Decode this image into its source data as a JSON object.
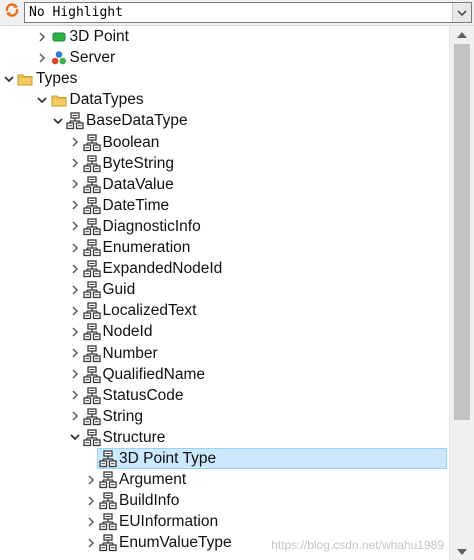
{
  "toolbar": {
    "refresh_icon": "refresh-icon",
    "highlight_value": "No Highlight"
  },
  "tree": {
    "rows": [
      {
        "label": "3D Point",
        "level": 1,
        "expander": "collapsed",
        "icon": "green-object-icon"
      },
      {
        "label": "Server",
        "level": 1,
        "expander": "collapsed",
        "icon": "server-icon"
      },
      {
        "label": "Types",
        "level": 0,
        "expander": "expanded",
        "icon": "folder-icon"
      },
      {
        "label": "DataTypes",
        "level": 1,
        "expander": "expanded",
        "icon": "folder-icon"
      },
      {
        "label": "BaseDataType",
        "level": 2,
        "expander": "expanded",
        "icon": "datatype-icon"
      },
      {
        "label": "Boolean",
        "level": 3,
        "expander": "collapsed",
        "icon": "datatype-icon"
      },
      {
        "label": "ByteString",
        "level": 3,
        "expander": "collapsed",
        "icon": "datatype-icon"
      },
      {
        "label": "DataValue",
        "level": 3,
        "expander": "collapsed",
        "icon": "datatype-icon"
      },
      {
        "label": "DateTime",
        "level": 3,
        "expander": "collapsed",
        "icon": "datatype-icon"
      },
      {
        "label": "DiagnosticInfo",
        "level": 3,
        "expander": "collapsed",
        "icon": "datatype-icon"
      },
      {
        "label": "Enumeration",
        "level": 3,
        "expander": "collapsed",
        "icon": "datatype-icon"
      },
      {
        "label": "ExpandedNodeId",
        "level": 3,
        "expander": "collapsed",
        "icon": "datatype-icon"
      },
      {
        "label": "Guid",
        "level": 3,
        "expander": "collapsed",
        "icon": "datatype-icon"
      },
      {
        "label": "LocalizedText",
        "level": 3,
        "expander": "collapsed",
        "icon": "datatype-icon"
      },
      {
        "label": "NodeId",
        "level": 3,
        "expander": "collapsed",
        "icon": "datatype-icon"
      },
      {
        "label": "Number",
        "level": 3,
        "expander": "collapsed",
        "icon": "datatype-icon"
      },
      {
        "label": "QualifiedName",
        "level": 3,
        "expander": "collapsed",
        "icon": "datatype-icon"
      },
      {
        "label": "StatusCode",
        "level": 3,
        "expander": "collapsed",
        "icon": "datatype-icon"
      },
      {
        "label": "String",
        "level": 3,
        "expander": "collapsed",
        "icon": "datatype-icon"
      },
      {
        "label": "Structure",
        "level": 3,
        "expander": "expanded",
        "icon": "datatype-icon"
      },
      {
        "label": "3D Point Type",
        "level": 4,
        "expander": "none",
        "icon": "datatype-icon",
        "selected": true
      },
      {
        "label": "Argument",
        "level": 4,
        "expander": "collapsed",
        "icon": "datatype-icon"
      },
      {
        "label": "BuildInfo",
        "level": 4,
        "expander": "collapsed",
        "icon": "datatype-icon"
      },
      {
        "label": "EUInformation",
        "level": 4,
        "expander": "collapsed",
        "icon": "datatype-icon"
      },
      {
        "label": "EnumValueType",
        "level": 4,
        "expander": "collapsed",
        "icon": "datatype-icon"
      }
    ]
  },
  "watermark": "https://blog.csdn.net/whahu1989",
  "colors": {
    "selection_bg": "#cce8ff",
    "selection_border": "#99d1ff",
    "folder": "#f4cc63",
    "datatype_icon": "#3a3a3a",
    "object_green": "#2fb34a",
    "refresh_orange": "#e8701a"
  }
}
